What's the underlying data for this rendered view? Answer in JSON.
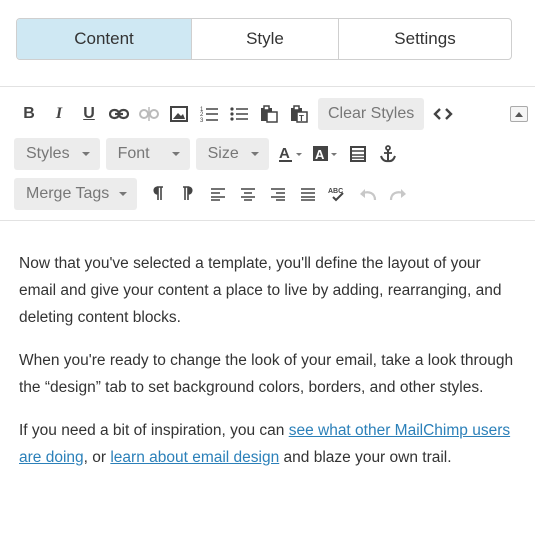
{
  "tabs": [
    {
      "label": "Content",
      "active": true
    },
    {
      "label": "Style",
      "active": false
    },
    {
      "label": "Settings",
      "active": false
    }
  ],
  "toolbar": {
    "row1": {
      "bold": "B",
      "italic": "I",
      "underline": "U",
      "icons": [
        "link-icon",
        "unlink-icon",
        "image-icon",
        "ordered-list-icon",
        "unordered-list-icon",
        "paste-icon",
        "paste-text-icon"
      ],
      "clear_styles": "Clear Styles",
      "source_icon": "code-icon"
    },
    "row2": {
      "styles": "Styles",
      "font": "Font",
      "size": "Size",
      "icons": [
        "text-color-icon",
        "background-color-icon",
        "table-icon",
        "anchor-icon"
      ]
    },
    "row3": {
      "merge_tags": "Merge Tags",
      "icons": [
        "ltr-icon",
        "rtl-icon",
        "align-left-icon",
        "align-center-icon",
        "align-right-icon",
        "align-justify-icon",
        "spellcheck-icon",
        "undo-icon",
        "redo-icon"
      ]
    },
    "collapse_icon": "collapse-toggle-icon"
  },
  "body": {
    "p1": "Now that you've selected a template, you'll define the layout of your email and give your content a place to live by adding, rearranging, and deleting content blocks.",
    "p2": "When you're ready to change the look of your email, take a look through the “design” tab to set background colors, borders, and other styles.",
    "p3_before": "If you need a bit of inspiration, you can ",
    "p3_link1": "see what other MailChimp users are doing",
    "p3_mid": ", or ",
    "p3_link2": "learn about email design",
    "p3_after": " and blaze your own trail."
  },
  "colors": {
    "active_tab": "#cfe8f3",
    "link": "#2b80b9",
    "button_bg": "#ececec"
  }
}
